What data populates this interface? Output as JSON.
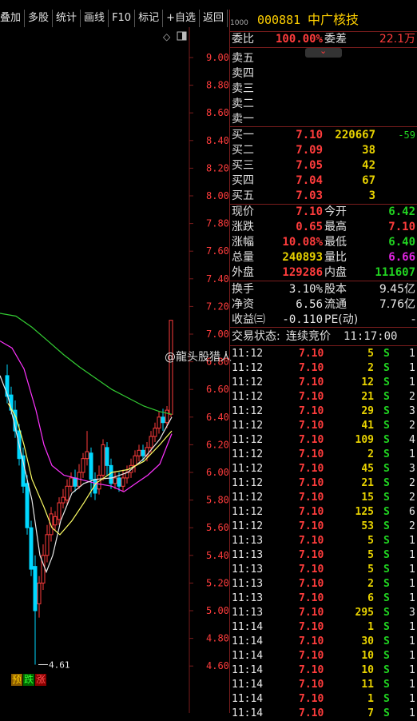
{
  "toolbar": {
    "items": [
      "叠加",
      "多股",
      "统计",
      "画线",
      "F10",
      "标记",
      "+自选",
      "返回"
    ]
  },
  "stock": {
    "code": "000881",
    "name": "中广核技",
    "code_prefix": "1000"
  },
  "order_book": {
    "wei_bi_label": "委比",
    "wei_bi": "100.00%",
    "wei_cha_label": "委差",
    "wei_cha": "22.1万",
    "sell_labels": [
      "卖五",
      "卖四",
      "卖三",
      "卖二",
      "卖一"
    ],
    "buy": [
      {
        "label": "买一",
        "price": "7.10",
        "volume": "220667",
        "change": "-59"
      },
      {
        "label": "买二",
        "price": "7.09",
        "volume": "38",
        "change": ""
      },
      {
        "label": "买三",
        "price": "7.05",
        "volume": "42",
        "change": ""
      },
      {
        "label": "买四",
        "price": "7.04",
        "volume": "67",
        "change": ""
      },
      {
        "label": "买五",
        "price": "7.03",
        "volume": "3",
        "change": ""
      }
    ]
  },
  "quote": {
    "rows": [
      {
        "l1": "现价",
        "v1": "7.10",
        "c1": "red",
        "l2": "今开",
        "v2": "6.42",
        "c2": "green"
      },
      {
        "l1": "涨跌",
        "v1": "0.65",
        "c1": "red",
        "l2": "最高",
        "v2": "7.10",
        "c2": "red"
      },
      {
        "l1": "涨幅",
        "v1": "10.08%",
        "c1": "red",
        "l2": "最低",
        "v2": "6.40",
        "c2": "green"
      },
      {
        "l1": "总量",
        "v1": "240893",
        "c1": "yellow",
        "l2": "量比",
        "v2": "6.66",
        "c2": "magenta"
      },
      {
        "l1": "外盘",
        "v1": "129286",
        "c1": "red",
        "l2": "内盘",
        "v2": "111607",
        "c2": "green"
      }
    ],
    "rows2": [
      {
        "l1": "换手",
        "v1": "3.10%",
        "l2": "股本",
        "v2": "9.45亿"
      },
      {
        "l1": "净资",
        "v1": "6.56",
        "l2": "流通",
        "v2": "7.76亿"
      },
      {
        "l1": "收益㈢",
        "v1": "-0.110",
        "l2": "PE(动)",
        "v2": "-"
      }
    ]
  },
  "trade_status": {
    "label": "交易状态:",
    "value": "连续竞价",
    "time": "11:17:00"
  },
  "ticks": [
    {
      "time": "11:12",
      "price": "7.10",
      "vol": "5",
      "side": "S",
      "n": "1"
    },
    {
      "time": "11:12",
      "price": "7.10",
      "vol": "2",
      "side": "S",
      "n": "1"
    },
    {
      "time": "11:12",
      "price": "7.10",
      "vol": "12",
      "side": "S",
      "n": "1"
    },
    {
      "time": "11:12",
      "price": "7.10",
      "vol": "21",
      "side": "S",
      "n": "2"
    },
    {
      "time": "11:12",
      "price": "7.10",
      "vol": "29",
      "side": "S",
      "n": "3"
    },
    {
      "time": "11:12",
      "price": "7.10",
      "vol": "41",
      "side": "S",
      "n": "2"
    },
    {
      "time": "11:12",
      "price": "7.10",
      "vol": "109",
      "side": "S",
      "n": "4"
    },
    {
      "time": "11:12",
      "price": "7.10",
      "vol": "2",
      "side": "S",
      "n": "1"
    },
    {
      "time": "11:12",
      "price": "7.10",
      "vol": "45",
      "side": "S",
      "n": "3"
    },
    {
      "time": "11:12",
      "price": "7.10",
      "vol": "21",
      "side": "S",
      "n": "2"
    },
    {
      "time": "11:12",
      "price": "7.10",
      "vol": "15",
      "side": "S",
      "n": "2"
    },
    {
      "time": "11:12",
      "price": "7.10",
      "vol": "125",
      "side": "S",
      "n": "6"
    },
    {
      "time": "11:12",
      "price": "7.10",
      "vol": "53",
      "side": "S",
      "n": "2"
    },
    {
      "time": "11:13",
      "price": "7.10",
      "vol": "5",
      "side": "S",
      "n": "1"
    },
    {
      "time": "11:13",
      "price": "7.10",
      "vol": "5",
      "side": "S",
      "n": "1"
    },
    {
      "time": "11:13",
      "price": "7.10",
      "vol": "5",
      "side": "S",
      "n": "1"
    },
    {
      "time": "11:13",
      "price": "7.10",
      "vol": "2",
      "side": "S",
      "n": "1"
    },
    {
      "time": "11:13",
      "price": "7.10",
      "vol": "6",
      "side": "S",
      "n": "1"
    },
    {
      "time": "11:13",
      "price": "7.10",
      "vol": "295",
      "side": "S",
      "n": "3"
    },
    {
      "time": "11:14",
      "price": "7.10",
      "vol": "1",
      "side": "S",
      "n": "1"
    },
    {
      "time": "11:14",
      "price": "7.10",
      "vol": "30",
      "side": "S",
      "n": "1"
    },
    {
      "time": "11:14",
      "price": "7.10",
      "vol": "10",
      "side": "S",
      "n": "1"
    },
    {
      "time": "11:14",
      "price": "7.10",
      "vol": "10",
      "side": "S",
      "n": "1"
    },
    {
      "time": "11:14",
      "price": "7.10",
      "vol": "11",
      "side": "S",
      "n": "1"
    },
    {
      "time": "11:14",
      "price": "7.10",
      "vol": "1",
      "side": "S",
      "n": "1"
    },
    {
      "time": "11:14",
      "price": "7.10",
      "vol": "7",
      "side": "S",
      "n": "1"
    }
  ],
  "chart": {
    "y_ticks": [
      "9.00",
      "8.80",
      "8.60",
      "8.40",
      "8.20",
      "8.00",
      "7.80",
      "7.60",
      "7.40",
      "7.20",
      "7.00",
      "6.80",
      "6.60",
      "6.40",
      "6.20",
      "6.00",
      "5.80",
      "5.60",
      "5.40",
      "5.20",
      "5.00",
      "4.80",
      "4.60"
    ],
    "low_marker": "4.61",
    "legend": [
      "预",
      "跌",
      "涨"
    ],
    "colors": {
      "up": "#ff3c3c",
      "down": "#00d8ff",
      "ma_white": "#e8e8e8",
      "ma_yellow": "#ffff66",
      "ma_magenta": "#ff33ff",
      "ma_green": "#33cc33",
      "grid": "#7a1d1d"
    }
  },
  "watermark": "@龍头股猎人"
}
